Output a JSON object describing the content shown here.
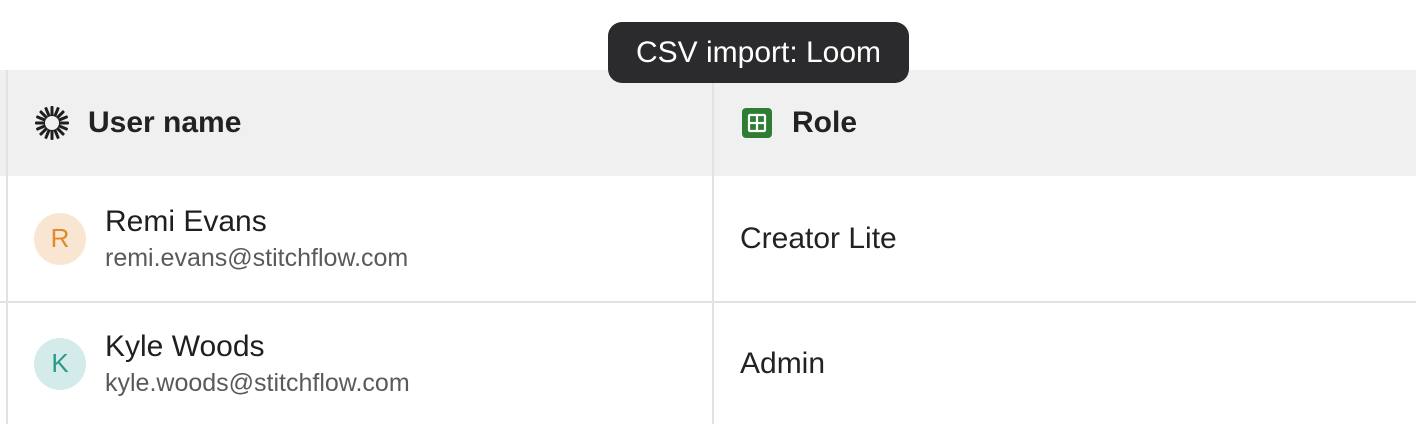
{
  "tooltip": {
    "text": "CSV import: Loom"
  },
  "table": {
    "columns": [
      {
        "label": "User name",
        "icon": "loom-logo-icon"
      },
      {
        "label": "Role",
        "icon": "spreadsheet-icon",
        "icon_color": "#2e7d32"
      }
    ],
    "rows": [
      {
        "avatar_initial": "R",
        "avatar_bg": "#f8e6d2",
        "avatar_fg": "#e08a2a",
        "name": "Remi Evans",
        "email": "remi.evans@stitchflow.com",
        "role": "Creator Lite"
      },
      {
        "avatar_initial": "K",
        "avatar_bg": "#d3ece9",
        "avatar_fg": "#2c9a88",
        "name": "Kyle Woods",
        "email": "kyle.woods@stitchflow.com",
        "role": "Admin"
      }
    ]
  }
}
